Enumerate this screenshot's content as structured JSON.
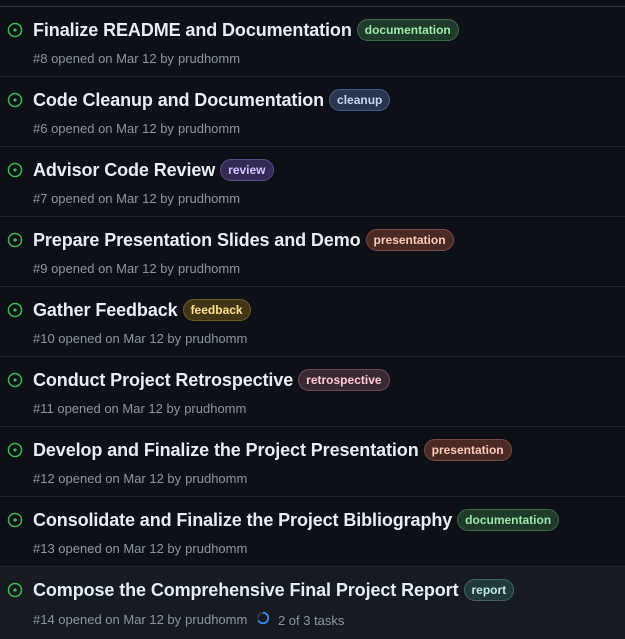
{
  "issues": [
    {
      "title": "Finalize README and Documentation",
      "label": {
        "text": "documentation",
        "fg": "#9be9a8",
        "bg": "#1f3a2a",
        "border": "#3a6b4a"
      },
      "meta": "#8 opened on Mar 12 by",
      "author": "prudhomm"
    },
    {
      "title": "Code Cleanup and Documentation",
      "label": {
        "text": "cleanup",
        "fg": "#c9d7f2",
        "bg": "#2a3550",
        "border": "#4a5a80"
      },
      "meta": "#6 opened on Mar 12 by",
      "author": "prudhomm"
    },
    {
      "title": "Advisor Code Review",
      "label": {
        "text": "review",
        "fg": "#d2c4ff",
        "bg": "#332a55",
        "border": "#5a4a8a"
      },
      "meta": "#7 opened on Mar 12 by",
      "author": "prudhomm"
    },
    {
      "title": "Prepare Presentation Slides and Demo",
      "label": {
        "text": "presentation",
        "fg": "#ffc9b8",
        "bg": "#4a2a25",
        "border": "#7a4a40"
      },
      "meta": "#9 opened on Mar 12 by",
      "author": "prudhomm"
    },
    {
      "title": "Gather Feedback",
      "label": {
        "text": "feedback",
        "fg": "#ffe08a",
        "bg": "#403515",
        "border": "#6e5a25"
      },
      "meta": "#10 opened on Mar 12 by",
      "author": "prudhomm"
    },
    {
      "title": "Conduct Project Retrospective",
      "label": {
        "text": "retrospective",
        "fg": "#ffc8d2",
        "bg": "#3a2a33",
        "border": "#6a4a58"
      },
      "meta": "#11 opened on Mar 12 by",
      "author": "prudhomm"
    },
    {
      "title": "Develop and Finalize the Project Presentation",
      "label": {
        "text": "presentation",
        "fg": "#ffc9b8",
        "bg": "#4a2a25",
        "border": "#7a4a40"
      },
      "meta": "#12 opened on Mar 12 by",
      "author": "prudhomm"
    },
    {
      "title": "Consolidate and Finalize the Project Bibliography",
      "label": {
        "text": "documentation",
        "fg": "#9be9a8",
        "bg": "#1f3a2a",
        "border": "#3a6b4a"
      },
      "meta": "#13 opened on Mar 12 by",
      "author": "prudhomm"
    },
    {
      "title": "Compose the Comprehensive Final Project Report",
      "label": {
        "text": "report",
        "fg": "#bfe8e0",
        "bg": "#22393a",
        "border": "#3f6466"
      },
      "meta": "#14 opened on Mar 12 by",
      "author": "prudhomm",
      "tasks": "2 of 3 tasks",
      "tasks_done": 2,
      "tasks_total": 3
    }
  ],
  "colors": {
    "open_icon": "#3fb950",
    "progress": "#388bfd"
  }
}
